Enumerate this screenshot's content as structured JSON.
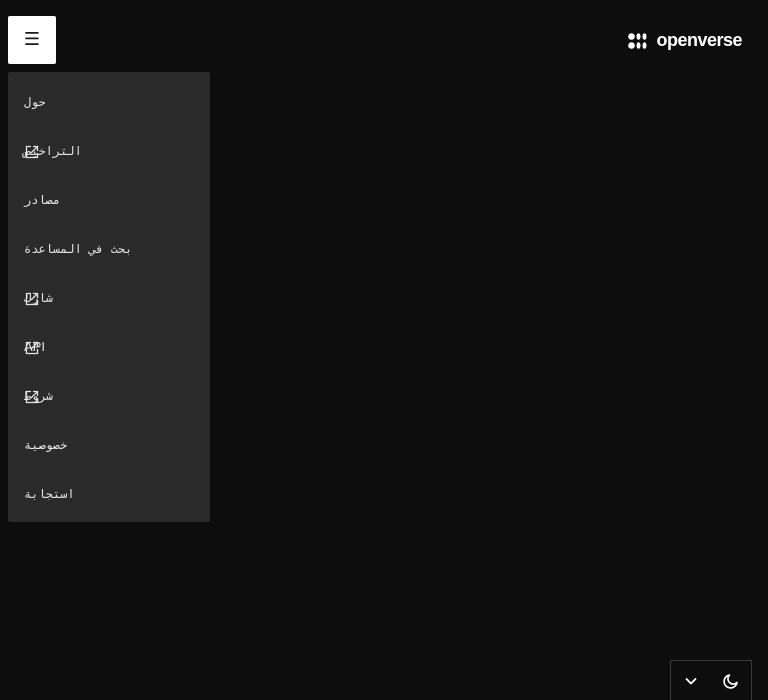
{
  "header": {
    "menu_icon_glyph": "☰",
    "brand_name": "openverse"
  },
  "menu": {
    "items": [
      {
        "label": "حول",
        "external": false
      },
      {
        "label": "التراخيص",
        "external": true
      },
      {
        "label": "مصادر",
        "external": false
      },
      {
        "label": "بحث في المساعدة",
        "external": false
      },
      {
        "label": "شارك",
        "external": true
      },
      {
        "label": "API",
        "external": true
      },
      {
        "label": "شروط",
        "external": true
      },
      {
        "label": "خصوصية",
        "external": false
      },
      {
        "label": "استجابة",
        "external": false
      }
    ]
  },
  "footer_controls": {
    "icons": [
      "chevron-down-icon",
      "moon-icon"
    ]
  },
  "colors": {
    "background": "#0d0d0d",
    "panel": "#2a2a2a",
    "text": "#e4e4e4",
    "button_bg": "#ffffff"
  }
}
